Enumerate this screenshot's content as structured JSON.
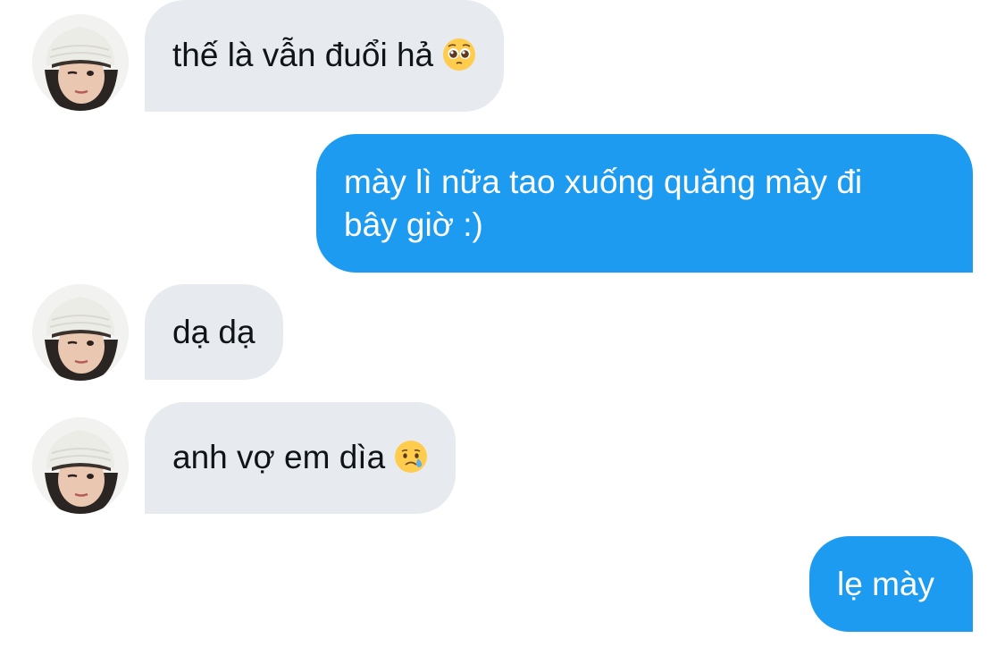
{
  "conversation": {
    "messages": [
      {
        "sender": "other",
        "text": "thế là vẫn đuổi hả",
        "emoji": "pleading-face-icon"
      },
      {
        "sender": "self",
        "lines": [
          "mày lì nữa tao xuống quăng mày đi",
          "bây giờ :)"
        ]
      },
      {
        "sender": "other",
        "text": "dạ dạ"
      },
      {
        "sender": "other",
        "text": "anh vợ em dìa",
        "emoji": "crying-face-icon"
      },
      {
        "sender": "self",
        "text": "lẹ mày"
      }
    ]
  },
  "colors": {
    "incoming_bubble": "#e7ebef",
    "outgoing_bubble": "#1d9bf0",
    "incoming_text": "#0f1419",
    "outgoing_text": "#ffffff"
  }
}
